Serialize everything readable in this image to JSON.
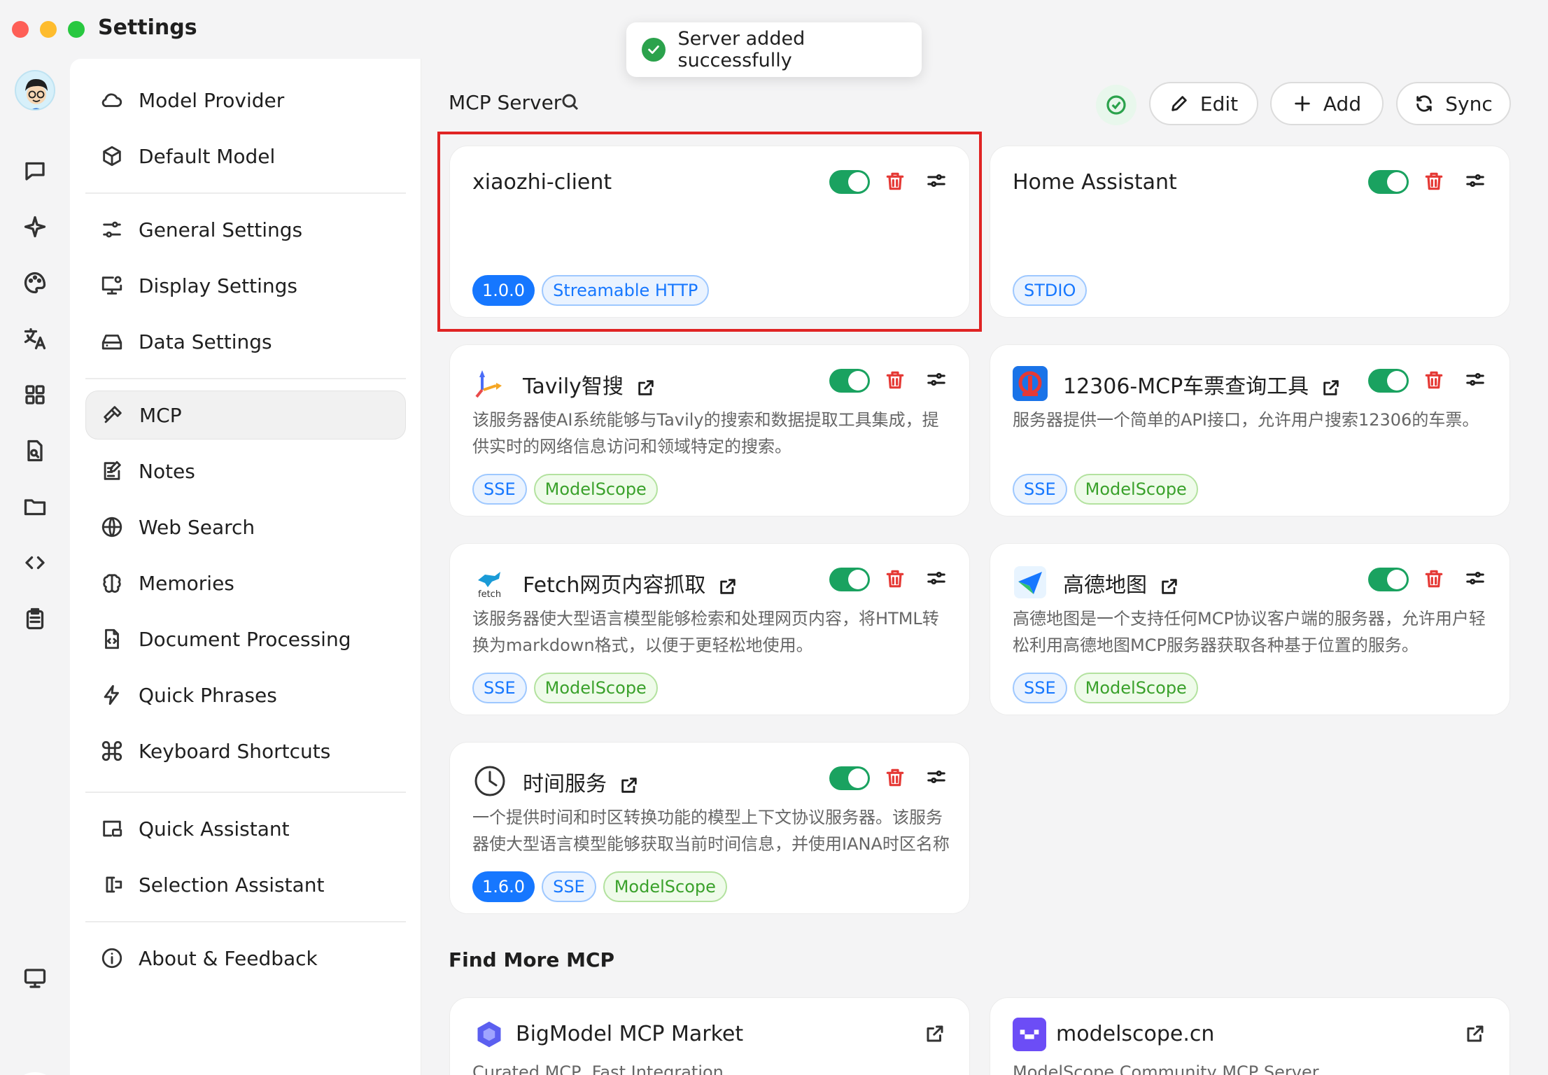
{
  "window": {
    "title": "Settings"
  },
  "toast": {
    "message": "Server added successfully"
  },
  "rail": {
    "items": [
      "avatar",
      "chat-icon",
      "sparkle-icon",
      "palette-icon",
      "translate-icon",
      "apps-icon",
      "doc-search-icon",
      "folder-icon",
      "code-icon",
      "clipboard-icon",
      "monitor-icon",
      "settings-icon"
    ]
  },
  "menu": {
    "items": [
      {
        "label": "Model Provider",
        "icon": "cloud-icon"
      },
      {
        "label": "Default Model",
        "icon": "cube-icon"
      },
      {
        "label": "General Settings",
        "icon": "sliders-icon"
      },
      {
        "label": "Display Settings",
        "icon": "monitor-gear-icon"
      },
      {
        "label": "Data Settings",
        "icon": "drive-icon"
      },
      {
        "label": "MCP",
        "icon": "hammer-icon"
      },
      {
        "label": "Notes",
        "icon": "note-icon"
      },
      {
        "label": "Web Search",
        "icon": "globe-icon"
      },
      {
        "label": "Memories",
        "icon": "brain-icon"
      },
      {
        "label": "Document Processing",
        "icon": "document-code-icon"
      },
      {
        "label": "Quick Phrases",
        "icon": "zap-icon"
      },
      {
        "label": "Keyboard Shortcuts",
        "icon": "command-icon"
      },
      {
        "label": "Quick Assistant",
        "icon": "window-icon"
      },
      {
        "label": "Selection Assistant",
        "icon": "text-cursor-icon"
      },
      {
        "label": "About & Feedback",
        "icon": "info-icon"
      }
    ],
    "active": "MCP"
  },
  "main": {
    "title": "MCP Server",
    "toolbar": {
      "edit": "Edit",
      "add": "Add",
      "sync": "Sync"
    },
    "servers": [
      {
        "name": "xiaozhi-client",
        "desc": "",
        "tags": [
          {
            "text": "1.0.0",
            "kind": "version"
          },
          {
            "text": "Streamable HTTP",
            "kind": "blue"
          }
        ],
        "enabled": true
      },
      {
        "name": "Home Assistant",
        "desc": "",
        "tags": [
          {
            "text": "STDIO",
            "kind": "blue"
          }
        ],
        "enabled": true
      },
      {
        "name": "Tavily智搜",
        "desc": "该服务器使AI系统能够与Tavily的搜索和数据提取工具集成，提供实时的网络信息访问和领域特定的搜索。",
        "tags": [
          {
            "text": "SSE",
            "kind": "blue"
          },
          {
            "text": "ModelScope",
            "kind": "green"
          }
        ],
        "enabled": true
      },
      {
        "name": "12306-MCP车票查询工具",
        "desc": "服务器提供一个简单的API接口，允许用户搜索12306的车票。",
        "tags": [
          {
            "text": "SSE",
            "kind": "blue"
          },
          {
            "text": "ModelScope",
            "kind": "green"
          }
        ],
        "enabled": true
      },
      {
        "name": "Fetch网页内容抓取",
        "desc": "该服务器使大型语言模型能够检索和处理网页内容，将HTML转换为markdown格式，以便于更轻松地使用。",
        "tags": [
          {
            "text": "SSE",
            "kind": "blue"
          },
          {
            "text": "ModelScope",
            "kind": "green"
          }
        ],
        "enabled": true
      },
      {
        "name": "高德地图",
        "desc": "高德地图是一个支持任何MCP协议客户端的服务器，允许用户轻松利用高德地图MCP服务器获取各种基于位置的服务。",
        "tags": [
          {
            "text": "SSE",
            "kind": "blue"
          },
          {
            "text": "ModelScope",
            "kind": "green"
          }
        ],
        "enabled": true
      },
      {
        "name": "时间服务",
        "desc": "一个提供时间和时区转换功能的模型上下文协议服务器。该服务器使大型语言模型能够获取当前时间信息，并使用IANA时区名称",
        "tags": [
          {
            "text": "1.6.0",
            "kind": "version"
          },
          {
            "text": "SSE",
            "kind": "blue"
          },
          {
            "text": "ModelScope",
            "kind": "green"
          }
        ],
        "enabled": true
      }
    ],
    "find_more": {
      "title": "Find More MCP",
      "items": [
        {
          "name": "BigModel MCP Market",
          "desc": "Curated MCP, Fast Integration"
        },
        {
          "name": "modelscope.cn",
          "desc": "ModelScope Community MCP Server"
        }
      ]
    }
  },
  "colors": {
    "accent": "#1aa260",
    "danger": "#e53935",
    "version_tag": "#1677ff",
    "highlight": "#e02424"
  }
}
